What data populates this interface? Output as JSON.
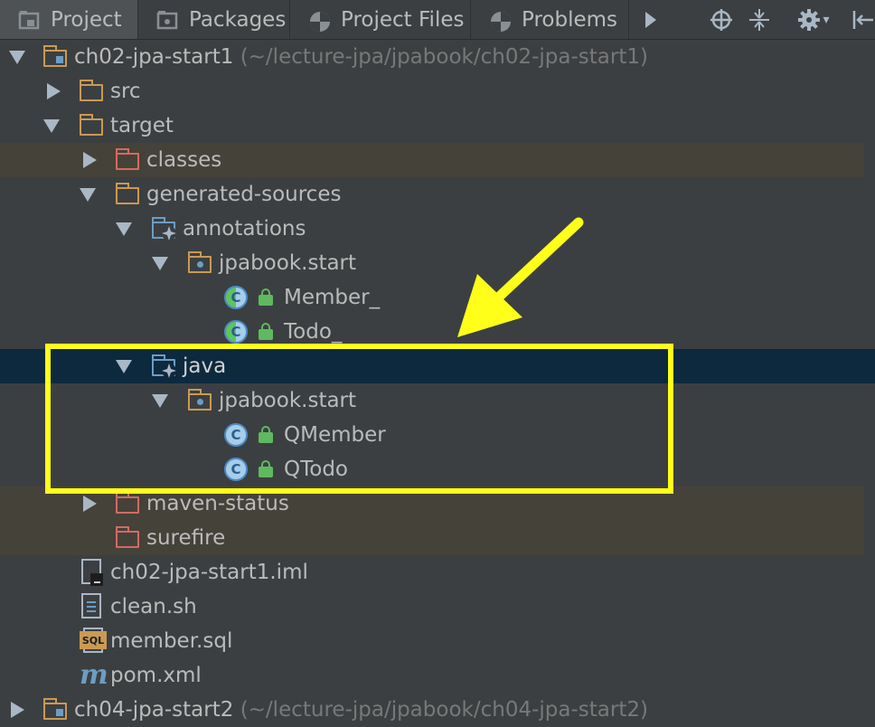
{
  "tabs": [
    {
      "label": "Project",
      "icon": "project-icon",
      "active": true
    },
    {
      "label": "Packages",
      "icon": "packages-icon",
      "active": false
    },
    {
      "label": "Project Files",
      "icon": "project-files-icon",
      "active": false
    },
    {
      "label": "Problems",
      "icon": "problems-icon",
      "active": false
    }
  ],
  "toolbar": {
    "more_icon": "chevron-right-icon",
    "target_icon": "crosshair-icon",
    "collapse_icon": "collapse-all-icon",
    "settings_icon": "gear-icon",
    "settings_dropdown": "▾",
    "hide_icon": "hide-panel-icon"
  },
  "tree": {
    "root": {
      "label": "ch02-jpa-start1",
      "path": "(~/lecture-jpa/jpabook/ch02-jpa-start1)"
    },
    "items": [
      {
        "label": "src"
      },
      {
        "label": "target"
      },
      {
        "label": "classes"
      },
      {
        "label": "generated-sources"
      },
      {
        "label": "annotations"
      },
      {
        "label": "jpabook.start"
      },
      {
        "label": "Member_",
        "class_letter": "C"
      },
      {
        "label": "Todo_",
        "class_letter": "C"
      },
      {
        "label": "java"
      },
      {
        "label": "jpabook.start"
      },
      {
        "label": "QMember",
        "class_letter": "C"
      },
      {
        "label": "QTodo",
        "class_letter": "C"
      },
      {
        "label": "maven-status"
      },
      {
        "label": "surefire"
      },
      {
        "label": "ch02-jpa-start1.iml"
      },
      {
        "label": "clean.sh"
      },
      {
        "label": "member.sql",
        "badge": "SQL"
      },
      {
        "label": "pom.xml",
        "badge": "m"
      }
    ],
    "next_root": {
      "label": "ch04-jpa-start2",
      "path": "(~/lecture-jpa/jpabook/ch04-jpa-start2)"
    }
  },
  "colors": {
    "background": "#3c3f41",
    "selection": "#0d293e",
    "excluded_row": "#45423a",
    "annotation": "#ffff1a"
  }
}
